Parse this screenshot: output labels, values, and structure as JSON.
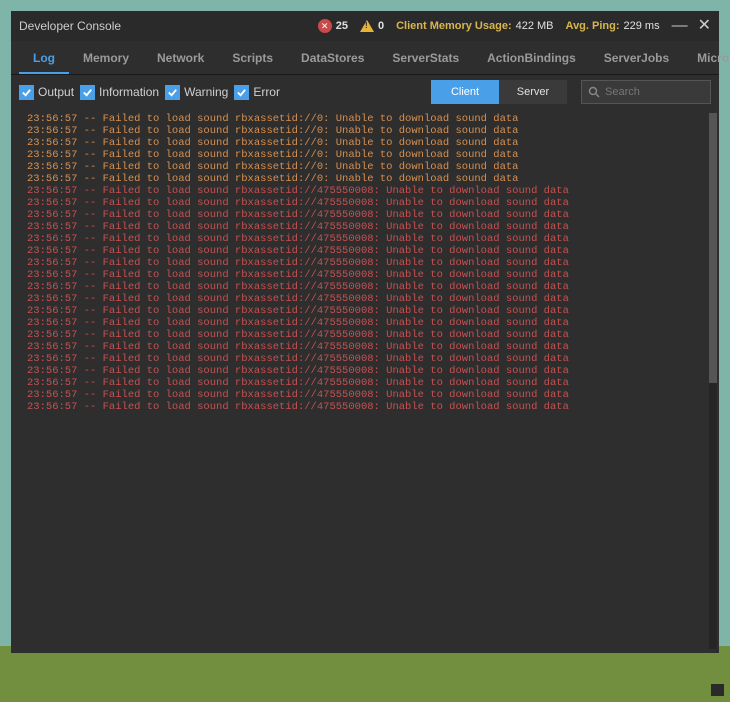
{
  "titlebar": {
    "title": "Developer Console",
    "error_count": "25",
    "warning_count": "0",
    "mem_label": "Client Memory Usage:",
    "mem_value": "422 MB",
    "ping_label": "Avg. Ping:",
    "ping_value": "229 ms"
  },
  "tabs": {
    "items": [
      {
        "label": "Log",
        "active": true
      },
      {
        "label": "Memory",
        "active": false
      },
      {
        "label": "Network",
        "active": false
      },
      {
        "label": "Scripts",
        "active": false
      },
      {
        "label": "DataStores",
        "active": false
      },
      {
        "label": "ServerStats",
        "active": false
      },
      {
        "label": "ActionBindings",
        "active": false
      },
      {
        "label": "ServerJobs",
        "active": false
      },
      {
        "label": "MicroProfiler",
        "active": false
      }
    ]
  },
  "filters": {
    "output": "Output",
    "information": "Information",
    "warning": "Warning",
    "error": "Error"
  },
  "toggle": {
    "client": "Client",
    "server": "Server"
  },
  "search": {
    "placeholder": "Search"
  },
  "log": {
    "entries": [
      {
        "ts": "23:56:57",
        "msg": "Failed to load sound rbxassetid://0: Unable to download sound data",
        "level": "orange"
      },
      {
        "ts": "23:56:57",
        "msg": "Failed to load sound rbxassetid://0: Unable to download sound data",
        "level": "orange"
      },
      {
        "ts": "23:56:57",
        "msg": "Failed to load sound rbxassetid://0: Unable to download sound data",
        "level": "orange"
      },
      {
        "ts": "23:56:57",
        "msg": "Failed to load sound rbxassetid://0: Unable to download sound data",
        "level": "orange"
      },
      {
        "ts": "23:56:57",
        "msg": "Failed to load sound rbxassetid://0: Unable to download sound data",
        "level": "orange"
      },
      {
        "ts": "23:56:57",
        "msg": "Failed to load sound rbxassetid://0: Unable to download sound data",
        "level": "orange"
      },
      {
        "ts": "23:56:57",
        "msg": "Failed to load sound rbxassetid://475550008: Unable to download sound data",
        "level": "red"
      },
      {
        "ts": "23:56:57",
        "msg": "Failed to load sound rbxassetid://475550008: Unable to download sound data",
        "level": "red"
      },
      {
        "ts": "23:56:57",
        "msg": "Failed to load sound rbxassetid://475550008: Unable to download sound data",
        "level": "red"
      },
      {
        "ts": "23:56:57",
        "msg": "Failed to load sound rbxassetid://475550008: Unable to download sound data",
        "level": "red"
      },
      {
        "ts": "23:56:57",
        "msg": "Failed to load sound rbxassetid://475550008: Unable to download sound data",
        "level": "red"
      },
      {
        "ts": "23:56:57",
        "msg": "Failed to load sound rbxassetid://475550008: Unable to download sound data",
        "level": "red"
      },
      {
        "ts": "23:56:57",
        "msg": "Failed to load sound rbxassetid://475550008: Unable to download sound data",
        "level": "red"
      },
      {
        "ts": "23:56:57",
        "msg": "Failed to load sound rbxassetid://475550008: Unable to download sound data",
        "level": "red"
      },
      {
        "ts": "23:56:57",
        "msg": "Failed to load sound rbxassetid://475550008: Unable to download sound data",
        "level": "red"
      },
      {
        "ts": "23:56:57",
        "msg": "Failed to load sound rbxassetid://475550008: Unable to download sound data",
        "level": "red"
      },
      {
        "ts": "23:56:57",
        "msg": "Failed to load sound rbxassetid://475550008: Unable to download sound data",
        "level": "red"
      },
      {
        "ts": "23:56:57",
        "msg": "Failed to load sound rbxassetid://475550008: Unable to download sound data",
        "level": "red"
      },
      {
        "ts": "23:56:57",
        "msg": "Failed to load sound rbxassetid://475550008: Unable to download sound data",
        "level": "red"
      },
      {
        "ts": "23:56:57",
        "msg": "Failed to load sound rbxassetid://475550008: Unable to download sound data",
        "level": "red"
      },
      {
        "ts": "23:56:57",
        "msg": "Failed to load sound rbxassetid://475550008: Unable to download sound data",
        "level": "red"
      },
      {
        "ts": "23:56:57",
        "msg": "Failed to load sound rbxassetid://475550008: Unable to download sound data",
        "level": "red"
      },
      {
        "ts": "23:56:57",
        "msg": "Failed to load sound rbxassetid://475550008: Unable to download sound data",
        "level": "red"
      },
      {
        "ts": "23:56:57",
        "msg": "Failed to load sound rbxassetid://475550008: Unable to download sound data",
        "level": "red"
      },
      {
        "ts": "23:56:57",
        "msg": "Failed to load sound rbxassetid://475550008: Unable to download sound data",
        "level": "red"
      }
    ]
  }
}
